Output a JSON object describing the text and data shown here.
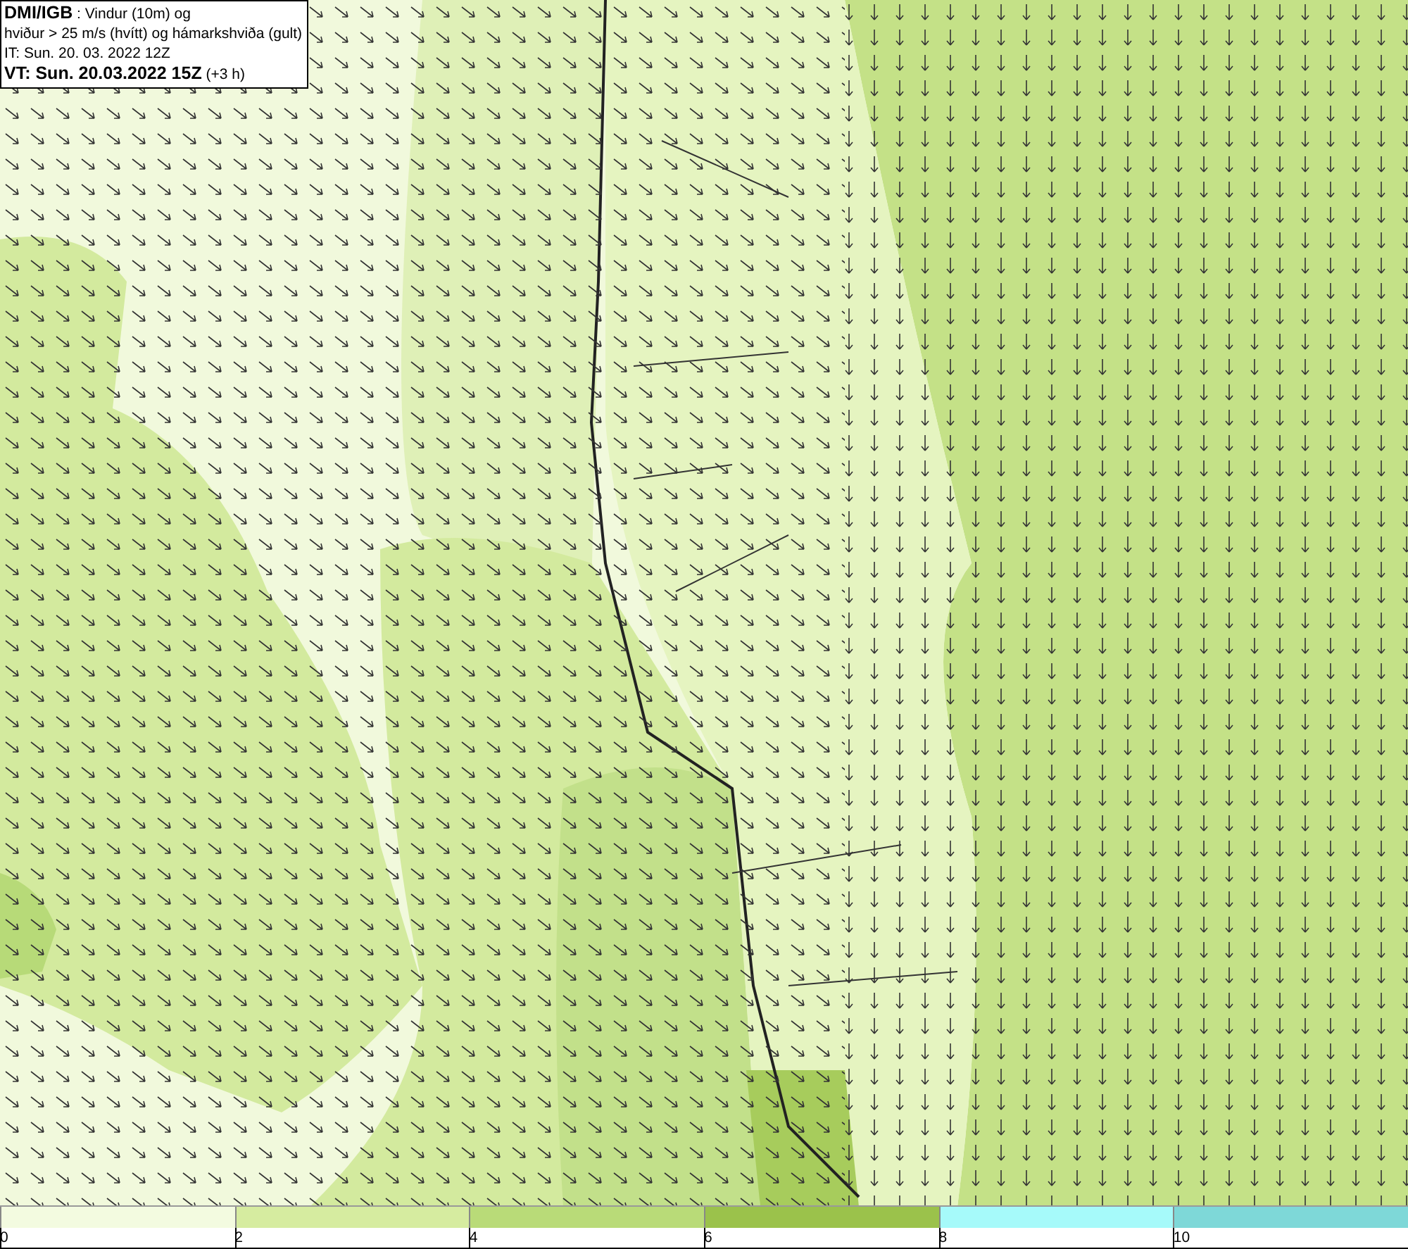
{
  "title_box": {
    "lines": [
      "**DMI/IGB** : Vindur (10m) og",
      "hviður > 25 m/s (hvítt) og hámarkshviða (gult)",
      "IT: Sun. 20. 03. 2022 12Z",
      "**VT: Sun. 20.03.2022 15Z** (+3 h)"
    ]
  },
  "legend": {
    "segments": [
      {
        "label": "0",
        "color": "#f3fbe0"
      },
      {
        "label": "2",
        "color": "#d6eca0"
      },
      {
        "label": "4",
        "color": "#b9db78"
      },
      {
        "label": "6",
        "color": "#9bc24b"
      },
      {
        "label": "8",
        "color": "#a6fafa"
      },
      {
        "label": "10",
        "color": "#7ed8d8"
      }
    ]
  }
}
